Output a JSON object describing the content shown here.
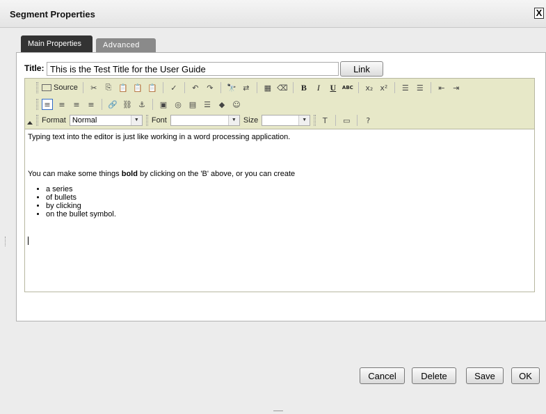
{
  "window": {
    "title": "Segment Properties",
    "close_glyph": "X"
  },
  "tabs": [
    {
      "label": "Main Properties",
      "active": true
    },
    {
      "label": "Advanced",
      "active": false
    }
  ],
  "title_field": {
    "label": "Title:",
    "value": "This is the Test Title for the User Guide"
  },
  "link_button": "Link",
  "toolbar": {
    "source_label": "Source",
    "format_label": "Format",
    "format_value": "Normal",
    "font_label": "Font",
    "font_value": "",
    "size_label": "Size",
    "size_value": "",
    "bold_glyph": "B",
    "italic_glyph": "I",
    "underline_glyph": "U",
    "strike_glyph": "ABC",
    "subscript_glyph": "x₂",
    "superscript_glyph": "x²",
    "help_glyph": "?"
  },
  "content": {
    "paragraph1": "Typing text into the editor is just like working in a word processing application.",
    "paragraph2_before": "You can make some things ",
    "paragraph2_bold": "bold",
    "paragraph2_after": " by clicking on the 'B' above, or you can create",
    "bullets": [
      "a series",
      "of bullets",
      "by clicking",
      "on the bullet symbol."
    ]
  },
  "buttons": {
    "cancel": "Cancel",
    "delete": "Delete",
    "save": "Save",
    "ok": "OK"
  }
}
